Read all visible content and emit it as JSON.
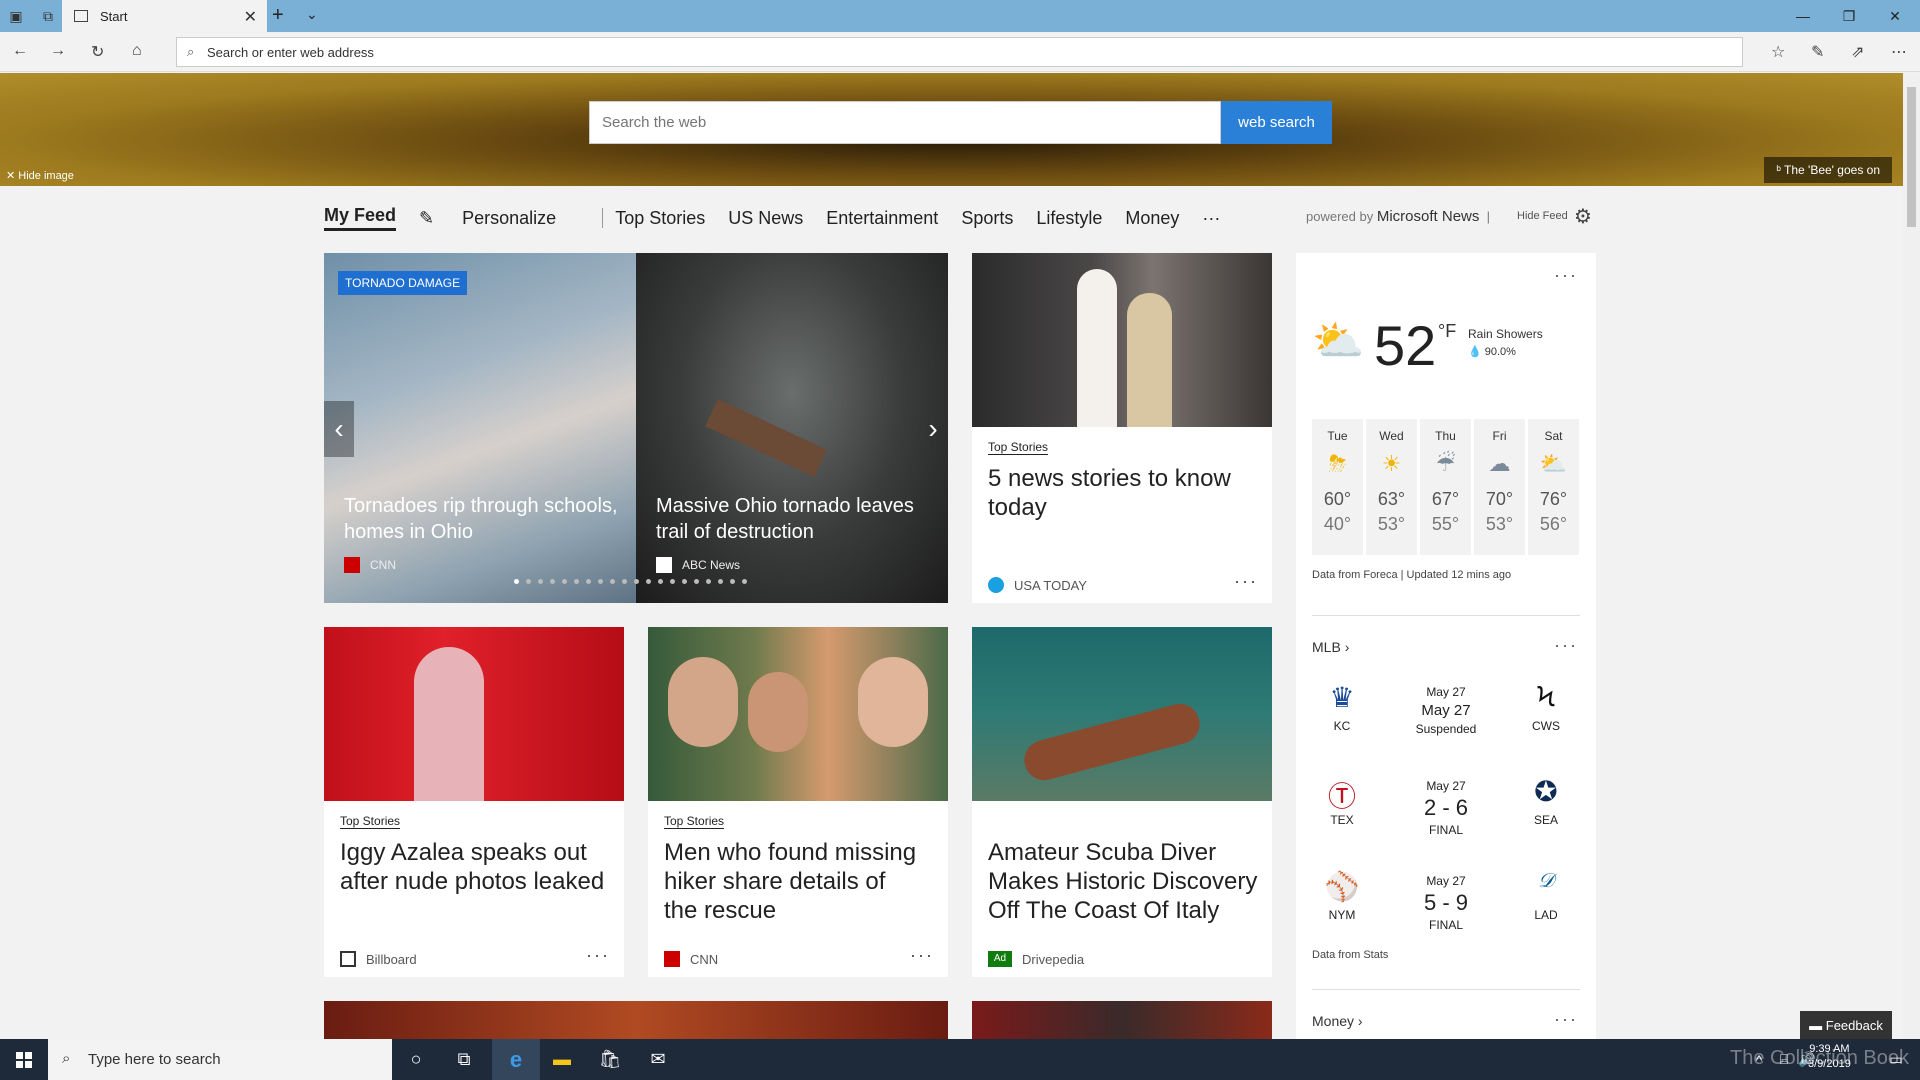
{
  "browser": {
    "tab_title": "Start",
    "address_placeholder": "Search or enter web address"
  },
  "hero": {
    "search_placeholder": "Search the web",
    "search_button": "web search",
    "hide_image": "Hide image",
    "caption": "The 'Bee' goes on"
  },
  "feed_nav": {
    "items": [
      "My Feed",
      "Personalize",
      "Top Stories",
      "US News",
      "Entertainment",
      "Sports",
      "Lifestyle",
      "Money",
      "···"
    ],
    "powered_prefix": "powered by",
    "powered_brand": "Microsoft News",
    "hide_feed": "Hide Feed"
  },
  "carousel": {
    "tag": "TORNADO DAMAGE",
    "slides": [
      {
        "title": "Tornadoes rip through schools, homes in Ohio",
        "source": "CNN"
      },
      {
        "title": "Massive Ohio tornado leaves trail of destruction",
        "source": "ABC News"
      }
    ],
    "dot_count": 20,
    "active_dot": 0
  },
  "cards": [
    {
      "tag": "Top Stories",
      "title": "5 news stories to know today",
      "source": "USA TODAY"
    },
    {
      "tag": "Top Stories",
      "title": "Iggy Azalea speaks out after nude photos leaked",
      "source": "Billboard"
    },
    {
      "tag": "Top Stories",
      "title": "Men who found missing hiker share details of the rescue",
      "source": "CNN"
    },
    {
      "tag": "",
      "title": "Amateur Scuba Diver Makes Historic Discovery Off The Coast Of Italy",
      "source": "Drivepedia",
      "ad_label": "Ad"
    }
  ],
  "weather": {
    "temp": "52",
    "unit": "°F",
    "condition": "Rain Showers",
    "precip": "90.0%",
    "forecast": [
      {
        "day": "Tue",
        "hi": "60°",
        "lo": "40°",
        "icon": "storm-sun"
      },
      {
        "day": "Wed",
        "hi": "63°",
        "lo": "53°",
        "icon": "sun"
      },
      {
        "day": "Thu",
        "hi": "67°",
        "lo": "55°",
        "icon": "rain"
      },
      {
        "day": "Fri",
        "hi": "70°",
        "lo": "53°",
        "icon": "cloud"
      },
      {
        "day": "Sat",
        "hi": "76°",
        "lo": "56°",
        "icon": "partly-sunny"
      }
    ],
    "note": "Data from Foreca | Updated 12 mins ago"
  },
  "mlb": {
    "header": "MLB",
    "games": [
      {
        "away": "KC",
        "home": "CWS",
        "date1": "May 27",
        "date2": "May 27",
        "status": "Suspended"
      },
      {
        "away": "TEX",
        "home": "SEA",
        "date1": "May 27",
        "score": "2 - 6",
        "status": "FINAL"
      },
      {
        "away": "NYM",
        "home": "LAD",
        "date1": "May 27",
        "score": "5 - 9",
        "status": "FINAL"
      }
    ],
    "note": "Data from Stats"
  },
  "money": {
    "header": "Money"
  },
  "feedback": "Feedback",
  "taskbar": {
    "search_placeholder": "Type here to search",
    "time": "9:39 AM",
    "date": "3/9/2019",
    "watermark": "The Collection Book"
  }
}
